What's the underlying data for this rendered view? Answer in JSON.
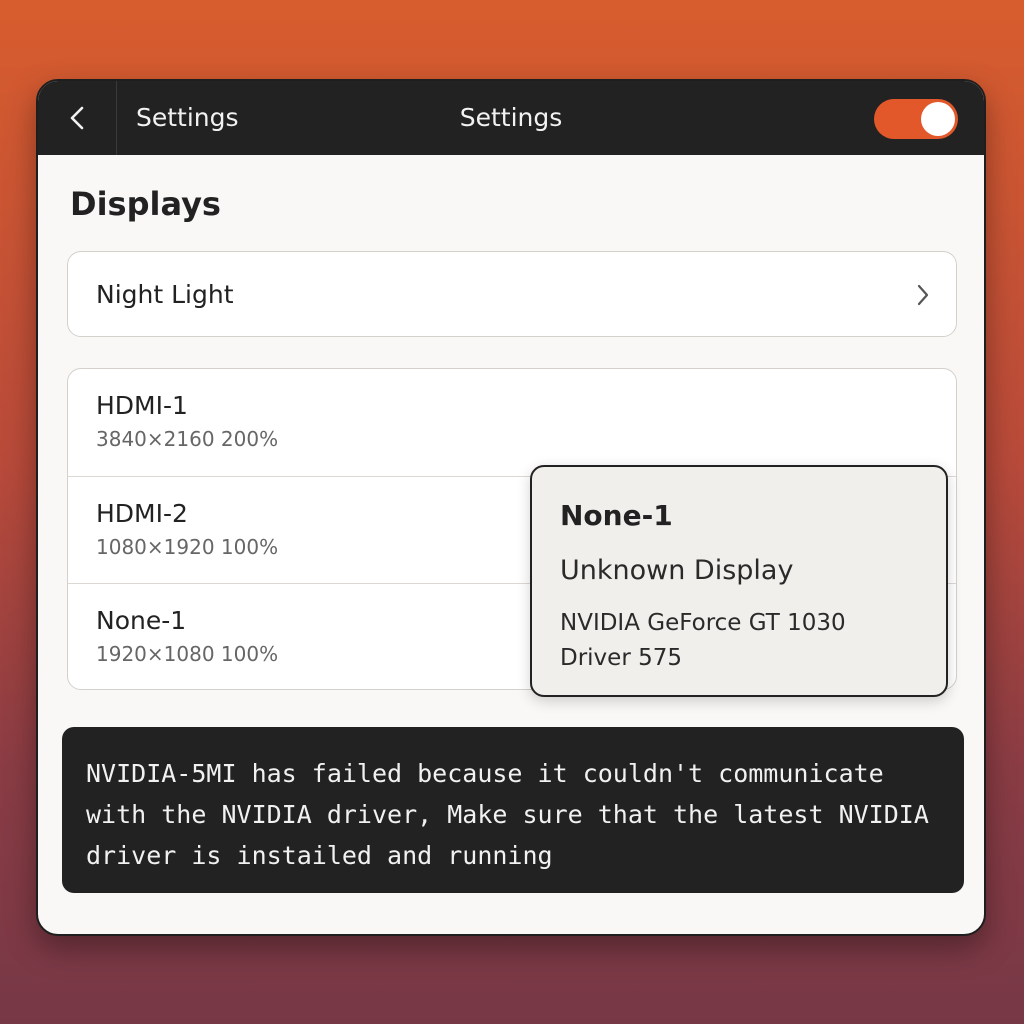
{
  "header": {
    "back_icon": "chevron-left-icon",
    "sidebar_title": "Settings",
    "title": "Settings",
    "toggle": {
      "state": "on",
      "color": "#e2582a"
    }
  },
  "page": {
    "section_title": "Displays"
  },
  "night_light": {
    "label": "Night Light",
    "icon": "chevron-right-icon"
  },
  "displays": [
    {
      "name": "HDMI-1",
      "resolution": "3840×2160  200%"
    },
    {
      "name": "HDMI-2",
      "resolution": "1080×1920  100%"
    },
    {
      "name": "None-1",
      "resolution": "1920×1080  100%"
    }
  ],
  "popover": {
    "title": "None-1",
    "subtitle": "Unknown Display",
    "gpu": "NVIDIA GeForce GT 1030",
    "driver": "Driver 575"
  },
  "error": {
    "message": "NVIDIA-5MI has failed because it couldn't communicate\nwith the NVIDIA driver, Make sure that the latest NVIDIA\ndriver is instailed and running"
  },
  "colors": {
    "accent": "#e2582a",
    "headerbar": "#222222",
    "window_bg": "#faf8f6"
  }
}
